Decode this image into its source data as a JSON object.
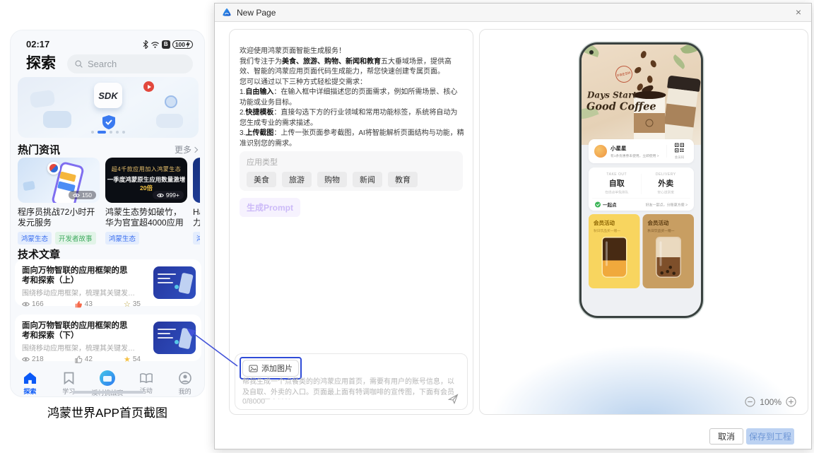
{
  "colors": {
    "accent_blue": "#0a59f7",
    "annotation_blue": "#4353d9",
    "tag_blue": "#3a6ff0",
    "tag_green": "#3faa5f",
    "like_red": "#f5694a",
    "star_yellow": "#f5c143",
    "save_button_bg": "#bcd2f2",
    "promo_yellow": "#f8d55f",
    "promo_tan": "#c89e62"
  },
  "left_screenshot": {
    "status_bar": {
      "time": "02:17",
      "battery_level": "100"
    },
    "header": {
      "title": "探索",
      "search_placeholder": "Search"
    },
    "banner": {
      "sdk_label": "SDK"
    },
    "hot_news": {
      "title": "热门资讯",
      "more_label": "更多",
      "cards": [
        {
          "views": "150",
          "title": "程序员挑战72小时开发元服务",
          "tag1": "鸿蒙生态",
          "tag2": "开发者故事"
        },
        {
          "views": "999+",
          "image_line1": "超4千款应用加入鸿蒙生态",
          "image_line2_pre": "一季度鸿蒙原生应用数量激增",
          "image_line2_highlight": "20倍",
          "title": "鸿蒙生态势如破竹，华为官宣超4000应用加...",
          "tag1": "鸿蒙生态"
        },
        {
          "title_line1": "Ha",
          "title_line2": "力",
          "tag1": "鸿"
        }
      ]
    },
    "articles": {
      "title": "技术文章",
      "items": [
        {
          "title": "面向万物智联的应用框架的思考和探索（上）",
          "desc": "围绕移动应用框架，梳理其关键发展...",
          "views": "166",
          "likes": "43",
          "stars": "35"
        },
        {
          "title": "面向万物智联的应用框架的思考和探索（下）",
          "desc": "围绕移动应用框架，梳理其关键发展...",
          "views": "218",
          "likes": "42",
          "stars": "54"
        }
      ]
    },
    "nav": {
      "items": [
        {
          "label": "探索"
        },
        {
          "label": "学习"
        },
        {
          "label": "溪村挑战赛"
        },
        {
          "label": "活动"
        },
        {
          "label": "我的"
        }
      ]
    },
    "caption": "鸿蒙世界APP首页截图"
  },
  "dialog": {
    "title": "New Page",
    "close": "×",
    "intro": {
      "line1": "欢迎使用鸿蒙页面智能生成服务！",
      "line2_pre": "我们专注于为",
      "line2_bold": "美食、旅游、购物、新闻和教育",
      "line2_post": "五大垂域场景，提供高效、智能的鸿蒙应用页面代码生成能力，帮您快速创建专属页面。",
      "line3": "您可以通过以下三种方式轻松提交需求：",
      "item1_num": "1.",
      "item1_bold": "自由输入",
      "item1_text": "：在输入框中详细描述您的页面需求，例如所需场景、核心功能或业务目标。",
      "item2_num": "2.",
      "item2_bold": "快捷模板",
      "item2_text": "：直接勾选下方的行业领域和常用功能标签，系统将自动为您生成专业的需求描述。",
      "item3_num": "3.",
      "item3_bold": "上传截图",
      "item3_text": "：上传一张页面参考截图，AI将智能解析页面结构与功能，精准识别您的需求。"
    },
    "app_type": {
      "label": "应用类型",
      "tags": [
        {
          "label": "美食"
        },
        {
          "label": "旅游"
        },
        {
          "label": "购物"
        },
        {
          "label": "新闻"
        },
        {
          "label": "教育"
        }
      ]
    },
    "generate_prompt_label": "生成Prompt",
    "input_area": {
      "add_image_label": "添加图片",
      "placeholder": "帮我生成一个点餐类的的鸿蒙应用首页，需要有用户的账号信息，以及自取、外卖的入口。页面最上面有特调咖啡的宣传图，下面有会员活动的图文链接",
      "counter": "0/8000"
    },
    "preview": {
      "coffee_banner": {
        "script_line1": "Days Start",
        "script_line2": "Good Coffee",
        "stamp": "FRESH"
      },
      "user_card": {
        "name": "小星星",
        "subtitle": "有1条优惠券未使用，立即使用 >",
        "qr_label": "会员码"
      },
      "order_card": {
        "takeout_en": "TAKE OUT",
        "takeout_cn": "自取",
        "takeout_sub": "在线点单免排队",
        "delivery_en": "DELIVERY",
        "delivery_cn": "外卖",
        "delivery_sub": "安心送到家",
        "group_label": "一起点",
        "group_text": "好友一起点，分账更方便 >"
      },
      "promo_cards": [
        {
          "title": "会员活动",
          "subtitle": "秋日饮品买一赠一"
        },
        {
          "title": "会员活动",
          "subtitle": "秋日饮品买一赠一"
        }
      ],
      "zoom_value": "100%"
    },
    "footer": {
      "cancel": "取消",
      "save": "保存到工程"
    }
  }
}
